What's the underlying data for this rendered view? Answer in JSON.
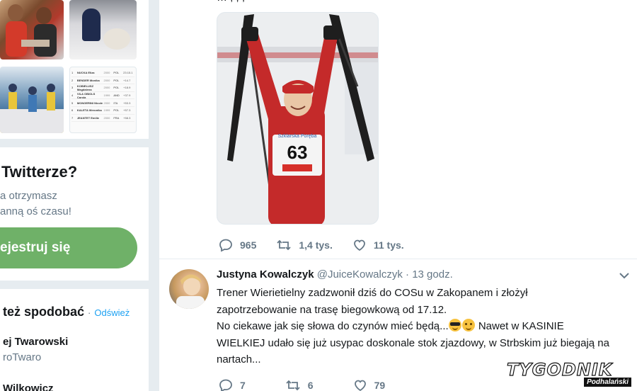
{
  "sidebar": {
    "results_table": [
      {
        "n": "1",
        "name": "NUCKA Eliza",
        "year": "2000",
        "nat": "POL",
        "time": "23:15.1"
      },
      {
        "n": "2",
        "name": "BENDER Monika",
        "year": "2000",
        "nat": "POL",
        "time": "+14.7"
      },
      {
        "n": "3",
        "name": "KOBIELUSZ Magdalena",
        "year": "2000",
        "nat": "POL",
        "time": "+18.9"
      },
      {
        "n": "4",
        "name": "VILA OBIOLS Carola",
        "year": "1999",
        "nat": "AND",
        "time": "+37.9"
      },
      {
        "n": "5",
        "name": "MONGERINI Nicole",
        "year": "2000",
        "nat": "ITA",
        "time": "+53.3"
      },
      {
        "n": "6",
        "name": "KALETA Weronika",
        "year": "1999",
        "nat": "POL",
        "time": "+57.3"
      },
      {
        "n": "7",
        "name": "JEANTET Emilie",
        "year": "2000",
        "nat": "FRA",
        "time": "+58.3"
      }
    ],
    "signup_title": "Twitterze?",
    "signup_line1": "a otrzymasz",
    "signup_line2": "anną oś czasu!",
    "signup_button": "ejestruj się",
    "wtf_title": "też spodobać",
    "wtf_dot": "·",
    "wtf_refresh": "Odśwież",
    "wtf_user1_name": "ej Twarowski",
    "wtf_user1_handle": "roTwaro",
    "wtf_user2_name": "Wilkowicz"
  },
  "tweet1": {
    "cut_text": "… , ,     ,",
    "bib_number": "63",
    "bib_sponsor": "Szklarska Poręba",
    "replies": "965",
    "retweets": "1,4 tys.",
    "likes": "11 tys."
  },
  "tweet2": {
    "name": "Justyna Kowalczyk",
    "handle": "@JuiceKowalczyk",
    "separator": "·",
    "time": "13 godz.",
    "line1": "Trener Wierietielny zadzwonił dziś do COSu w Zakopanem i złożył",
    "line2": "zapotrzebowanie na trasę biegowkową od 17.12.",
    "line3_before": "No ciekawe jak się słowa do czynów mieć będą...",
    "line3_after": " Nawet w KASINIE",
    "line4": "WIELKIEJ udało się już usypac doskonale stok zjazdowy, w Strbskim już biegają na",
    "line5": "nartach...",
    "replies": "7",
    "retweets": "6",
    "likes": "79"
  },
  "watermark": {
    "main": "TYGODNIK",
    "sub": "Podhalański"
  },
  "colors": {
    "background": "#e6ecf0",
    "signup_button": "#6fb168",
    "link": "#1da1f2",
    "muted": "#657786"
  }
}
